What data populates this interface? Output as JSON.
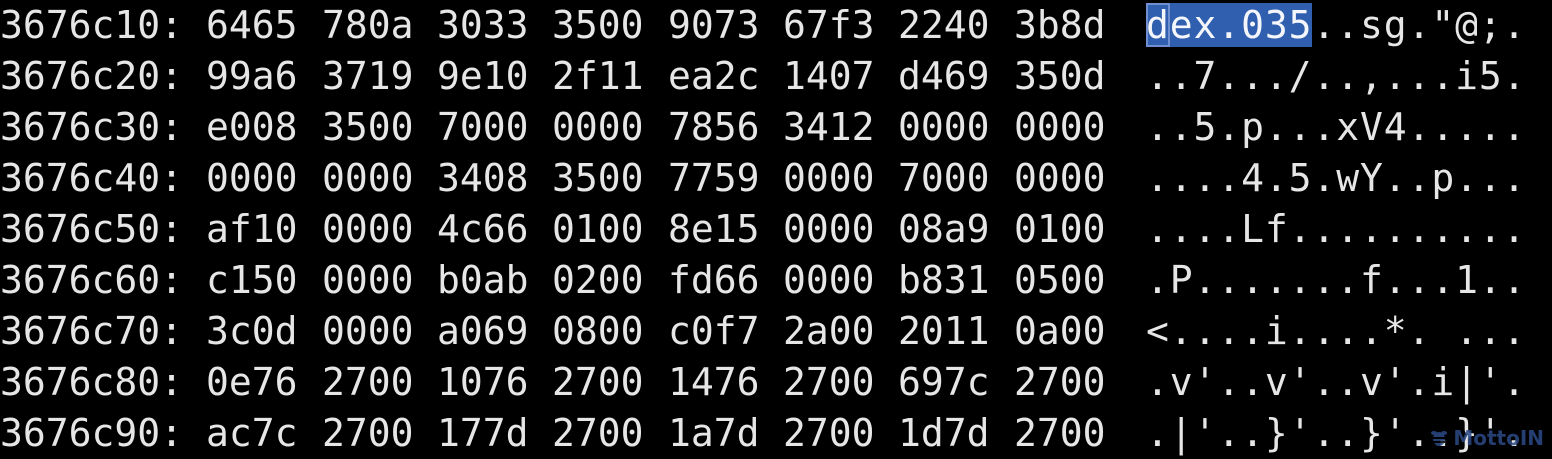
{
  "hexdump": {
    "rows": [
      {
        "address": "3676c10:",
        "words": [
          "6465",
          "780a",
          "3033",
          "3500",
          "9073",
          "67f3",
          "2240",
          "3b8d"
        ],
        "ascii": "dex.035..sg.\"@;.",
        "selection_length": 7
      },
      {
        "address": "3676c20:",
        "words": [
          "99a6",
          "3719",
          "9e10",
          "2f11",
          "ea2c",
          "1407",
          "d469",
          "350d"
        ],
        "ascii": "..7.../..,...i5."
      },
      {
        "address": "3676c30:",
        "words": [
          "e008",
          "3500",
          "7000",
          "0000",
          "7856",
          "3412",
          "0000",
          "0000"
        ],
        "ascii": "..5.p...xV4....."
      },
      {
        "address": "3676c40:",
        "words": [
          "0000",
          "0000",
          "3408",
          "3500",
          "7759",
          "0000",
          "7000",
          "0000"
        ],
        "ascii": "....4.5.wY..p..."
      },
      {
        "address": "3676c50:",
        "words": [
          "af10",
          "0000",
          "4c66",
          "0100",
          "8e15",
          "0000",
          "08a9",
          "0100"
        ],
        "ascii": "....Lf.........."
      },
      {
        "address": "3676c60:",
        "words": [
          "c150",
          "0000",
          "b0ab",
          "0200",
          "fd66",
          "0000",
          "b831",
          "0500"
        ],
        "ascii": ".P.......f...1.."
      },
      {
        "address": "3676c70:",
        "words": [
          "3c0d",
          "0000",
          "a069",
          "0800",
          "c0f7",
          "2a00",
          "2011",
          "0a00"
        ],
        "ascii": "<....i....*. ..."
      },
      {
        "address": "3676c80:",
        "words": [
          "0e76",
          "2700",
          "1076",
          "2700",
          "1476",
          "2700",
          "697c",
          "2700"
        ],
        "ascii": ".v'..v'..v'.i|'."
      },
      {
        "address": "3676c90:",
        "words": [
          "ac7c",
          "2700",
          "177d",
          "2700",
          "1a7d",
          "2700",
          "1d7d",
          "2700"
        ],
        "ascii": ".|'..}'..}'..}'."
      }
    ]
  },
  "watermark": {
    "text": "MottoIN",
    "icon": "bee-logo-icon"
  },
  "colors": {
    "background": "#000000",
    "text": "#e6e6e6",
    "selection": "#2f5fae",
    "watermark": "#2c4a86"
  }
}
